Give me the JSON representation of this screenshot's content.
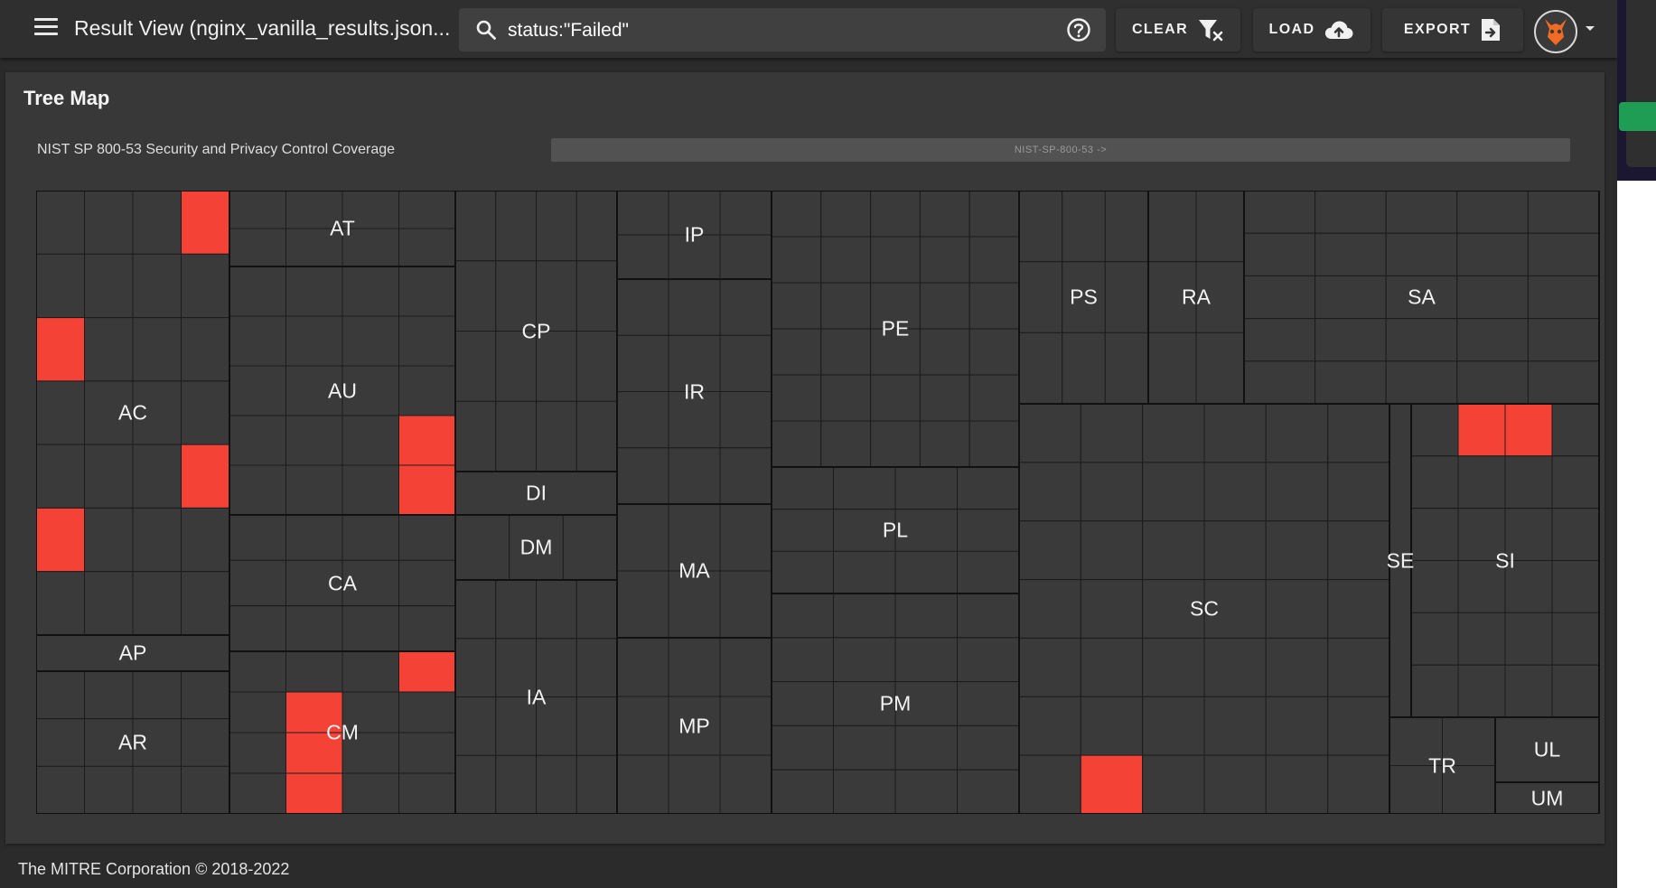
{
  "app": {
    "title": "Result View (nginx_vanilla_results.json...",
    "search_value": "status:\"Failed\"",
    "buttons": {
      "clear": "CLEAR",
      "load": "LOAD",
      "export": "EXPORT"
    }
  },
  "icons": [
    "menu-icon",
    "search-icon",
    "help-icon",
    "filter-remove-icon",
    "cloud-upload-icon",
    "file-export-icon",
    "user-avatar-icon",
    "chevron-down-icon"
  ],
  "card": {
    "title": "Tree Map",
    "subtitle": "NIST SP 800-53 Security and Privacy Control Coverage",
    "breadcrumb": "NIST-SP-800-53 ->"
  },
  "colors": {
    "failed": "#f44336",
    "cell": "#3a3a3a",
    "background": "#2b2b2b",
    "card": "#383838"
  },
  "treemap": {
    "families": [
      "AC",
      "AT",
      "AU",
      "CA",
      "CM",
      "AP",
      "AR",
      "CP",
      "DI",
      "DM",
      "IA",
      "IP",
      "IR",
      "MA",
      "MP",
      "PE",
      "PL",
      "PM",
      "PS",
      "RA",
      "SA",
      "SC",
      "SE",
      "SI",
      "TR",
      "UL",
      "UM"
    ],
    "failed_controls": 13
  },
  "footer": {
    "text": "The MITRE Corporation © 2018-2022"
  }
}
